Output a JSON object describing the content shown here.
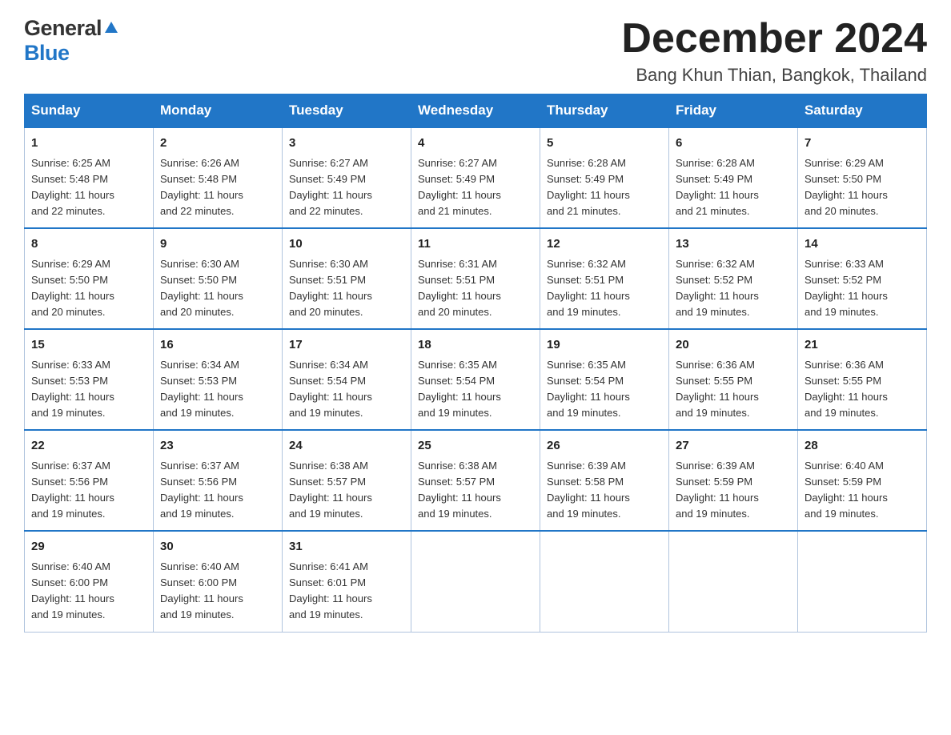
{
  "header": {
    "logo_general": "General",
    "logo_arrow": "▶",
    "logo_blue": "Blue",
    "title": "December 2024",
    "subtitle": "Bang Khun Thian, Bangkok, Thailand"
  },
  "days_of_week": [
    "Sunday",
    "Monday",
    "Tuesday",
    "Wednesday",
    "Thursday",
    "Friday",
    "Saturday"
  ],
  "weeks": [
    [
      {
        "day": "1",
        "info": "Sunrise: 6:25 AM\nSunset: 5:48 PM\nDaylight: 11 hours\nand 22 minutes."
      },
      {
        "day": "2",
        "info": "Sunrise: 6:26 AM\nSunset: 5:48 PM\nDaylight: 11 hours\nand 22 minutes."
      },
      {
        "day": "3",
        "info": "Sunrise: 6:27 AM\nSunset: 5:49 PM\nDaylight: 11 hours\nand 22 minutes."
      },
      {
        "day": "4",
        "info": "Sunrise: 6:27 AM\nSunset: 5:49 PM\nDaylight: 11 hours\nand 21 minutes."
      },
      {
        "day": "5",
        "info": "Sunrise: 6:28 AM\nSunset: 5:49 PM\nDaylight: 11 hours\nand 21 minutes."
      },
      {
        "day": "6",
        "info": "Sunrise: 6:28 AM\nSunset: 5:49 PM\nDaylight: 11 hours\nand 21 minutes."
      },
      {
        "day": "7",
        "info": "Sunrise: 6:29 AM\nSunset: 5:50 PM\nDaylight: 11 hours\nand 20 minutes."
      }
    ],
    [
      {
        "day": "8",
        "info": "Sunrise: 6:29 AM\nSunset: 5:50 PM\nDaylight: 11 hours\nand 20 minutes."
      },
      {
        "day": "9",
        "info": "Sunrise: 6:30 AM\nSunset: 5:50 PM\nDaylight: 11 hours\nand 20 minutes."
      },
      {
        "day": "10",
        "info": "Sunrise: 6:30 AM\nSunset: 5:51 PM\nDaylight: 11 hours\nand 20 minutes."
      },
      {
        "day": "11",
        "info": "Sunrise: 6:31 AM\nSunset: 5:51 PM\nDaylight: 11 hours\nand 20 minutes."
      },
      {
        "day": "12",
        "info": "Sunrise: 6:32 AM\nSunset: 5:51 PM\nDaylight: 11 hours\nand 19 minutes."
      },
      {
        "day": "13",
        "info": "Sunrise: 6:32 AM\nSunset: 5:52 PM\nDaylight: 11 hours\nand 19 minutes."
      },
      {
        "day": "14",
        "info": "Sunrise: 6:33 AM\nSunset: 5:52 PM\nDaylight: 11 hours\nand 19 minutes."
      }
    ],
    [
      {
        "day": "15",
        "info": "Sunrise: 6:33 AM\nSunset: 5:53 PM\nDaylight: 11 hours\nand 19 minutes."
      },
      {
        "day": "16",
        "info": "Sunrise: 6:34 AM\nSunset: 5:53 PM\nDaylight: 11 hours\nand 19 minutes."
      },
      {
        "day": "17",
        "info": "Sunrise: 6:34 AM\nSunset: 5:54 PM\nDaylight: 11 hours\nand 19 minutes."
      },
      {
        "day": "18",
        "info": "Sunrise: 6:35 AM\nSunset: 5:54 PM\nDaylight: 11 hours\nand 19 minutes."
      },
      {
        "day": "19",
        "info": "Sunrise: 6:35 AM\nSunset: 5:54 PM\nDaylight: 11 hours\nand 19 minutes."
      },
      {
        "day": "20",
        "info": "Sunrise: 6:36 AM\nSunset: 5:55 PM\nDaylight: 11 hours\nand 19 minutes."
      },
      {
        "day": "21",
        "info": "Sunrise: 6:36 AM\nSunset: 5:55 PM\nDaylight: 11 hours\nand 19 minutes."
      }
    ],
    [
      {
        "day": "22",
        "info": "Sunrise: 6:37 AM\nSunset: 5:56 PM\nDaylight: 11 hours\nand 19 minutes."
      },
      {
        "day": "23",
        "info": "Sunrise: 6:37 AM\nSunset: 5:56 PM\nDaylight: 11 hours\nand 19 minutes."
      },
      {
        "day": "24",
        "info": "Sunrise: 6:38 AM\nSunset: 5:57 PM\nDaylight: 11 hours\nand 19 minutes."
      },
      {
        "day": "25",
        "info": "Sunrise: 6:38 AM\nSunset: 5:57 PM\nDaylight: 11 hours\nand 19 minutes."
      },
      {
        "day": "26",
        "info": "Sunrise: 6:39 AM\nSunset: 5:58 PM\nDaylight: 11 hours\nand 19 minutes."
      },
      {
        "day": "27",
        "info": "Sunrise: 6:39 AM\nSunset: 5:59 PM\nDaylight: 11 hours\nand 19 minutes."
      },
      {
        "day": "28",
        "info": "Sunrise: 6:40 AM\nSunset: 5:59 PM\nDaylight: 11 hours\nand 19 minutes."
      }
    ],
    [
      {
        "day": "29",
        "info": "Sunrise: 6:40 AM\nSunset: 6:00 PM\nDaylight: 11 hours\nand 19 minutes."
      },
      {
        "day": "30",
        "info": "Sunrise: 6:40 AM\nSunset: 6:00 PM\nDaylight: 11 hours\nand 19 minutes."
      },
      {
        "day": "31",
        "info": "Sunrise: 6:41 AM\nSunset: 6:01 PM\nDaylight: 11 hours\nand 19 minutes."
      },
      {
        "day": "",
        "info": ""
      },
      {
        "day": "",
        "info": ""
      },
      {
        "day": "",
        "info": ""
      },
      {
        "day": "",
        "info": ""
      }
    ]
  ]
}
